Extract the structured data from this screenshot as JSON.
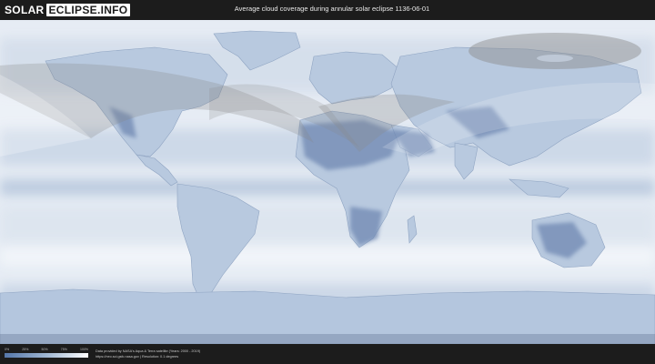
{
  "logo": {
    "part1": "SOLAR",
    "part2": "ECLIPSE.INFO"
  },
  "title": "Average cloud coverage during annular solar eclipse 1136-06-01",
  "legend": {
    "ticks": [
      "0%",
      "25%",
      "50%",
      "75%",
      "100%"
    ],
    "color_low": "#5577aa",
    "color_high": "#ffffff"
  },
  "footer": {
    "credit_line1": "Data provided by NASA's Aqua & Terra satellite (Years: 2000 - 2019)",
    "credit_line2": "https://neo.sci.gsfc.nasa.gov  |  Resolution: 0.1 degrees"
  },
  "map": {
    "ocean_color": "#e9eef5",
    "land_color": "#c2d0e2",
    "eclipse_overlay_color": "#8a8a8a"
  }
}
